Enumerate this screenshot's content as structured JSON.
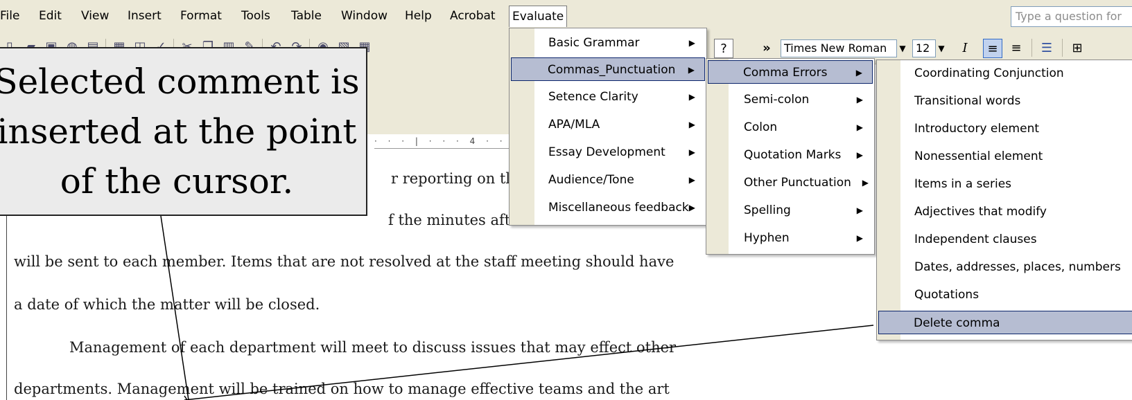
{
  "menubar": {
    "items": [
      "File",
      "Edit",
      "View",
      "Insert",
      "Format",
      "Tools",
      "Table",
      "Window",
      "Help",
      "Acrobat",
      "Evaluate"
    ],
    "active": "Evaluate",
    "question_placeholder": "Type a question for"
  },
  "toolbar": {
    "font_name": "Times New Roman",
    "font_size": "12",
    "italic_label": "I",
    "overflow_label": "»",
    "help_label": "?"
  },
  "ruler": {
    "text": "· · · | · · · 4 · ·"
  },
  "callout": {
    "lines": [
      "Selected comment is",
      "inserted at the point",
      "of the cursor."
    ]
  },
  "document": {
    "lines": [
      "r reporting on tl",
      "f the minutes aft",
      "will be sent to each member. Items that are not resolved at the staff meeting should have",
      "a date of which the matter will be closed.",
      "Management of each department will meet to discuss issues that may effect other",
      "departments. Management will be trained on how to manage effective teams and the art"
    ]
  },
  "evaluate_menu": {
    "items": [
      {
        "label": "Basic Grammar",
        "highlighted": false
      },
      {
        "label": "Commas_Punctuation",
        "highlighted": true
      },
      {
        "label": "Setence Clarity",
        "highlighted": false
      },
      {
        "label": "APA/MLA",
        "highlighted": false
      },
      {
        "label": "Essay Development",
        "highlighted": false
      },
      {
        "label": "Audience/Tone",
        "highlighted": false
      },
      {
        "label": "Miscellaneous feedback",
        "highlighted": false
      }
    ]
  },
  "commas_menu": {
    "items": [
      {
        "label": "Comma Errors",
        "highlighted": true
      },
      {
        "label": "Semi-colon",
        "highlighted": false
      },
      {
        "label": "Colon",
        "highlighted": false
      },
      {
        "label": "Quotation Marks",
        "highlighted": false
      },
      {
        "label": "Other Punctuation",
        "highlighted": false
      },
      {
        "label": "Spelling",
        "highlighted": false
      },
      {
        "label": "Hyphen",
        "highlighted": false
      }
    ]
  },
  "comma_errors_menu": {
    "items": [
      {
        "label": "Coordinating Conjunction",
        "highlighted": false
      },
      {
        "label": "Transitional words",
        "highlighted": false
      },
      {
        "label": "Introductory element",
        "highlighted": false
      },
      {
        "label": "Nonessential element",
        "highlighted": false
      },
      {
        "label": "Items in a series",
        "highlighted": false
      },
      {
        "label": "Adjectives that modify",
        "highlighted": false
      },
      {
        "label": "Independent clauses",
        "highlighted": false
      },
      {
        "label": "Dates, addresses, places, numbers",
        "highlighted": false
      },
      {
        "label": "Quotations",
        "highlighted": false
      },
      {
        "label": "Delete comma",
        "highlighted": true
      }
    ]
  },
  "colors": {
    "chrome": "#ece9d8",
    "menu_highlight": "#b6bdd2",
    "menu_highlight_border": "#0a246a",
    "callout_fill": "#ebebeb"
  }
}
